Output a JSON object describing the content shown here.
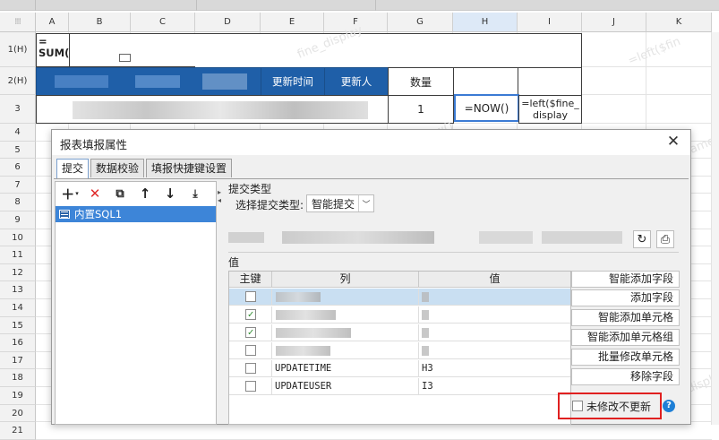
{
  "sheet": {
    "columns": [
      "A",
      "B",
      "C",
      "D",
      "E",
      "F",
      "G",
      "H",
      "I",
      "J",
      "K"
    ],
    "rows": [
      "1(H)",
      "2(H)",
      "3",
      "4",
      "5",
      "6",
      "7",
      "8",
      "9",
      "10",
      "11",
      "12",
      "13",
      "14",
      "15",
      "16",
      "17",
      "18",
      "19",
      "20",
      "21"
    ],
    "cells": {
      "a1": "= SUM(",
      "e2": "更新时间",
      "f2": "更新人",
      "g2": "数量",
      "g3": "1",
      "h3": "=NOW()",
      "i3": "=left($fine_display"
    },
    "watermarks": [
      "fine_display",
      "=left($fin",
      "now()",
      "ame",
      "_display"
    ]
  },
  "dialog": {
    "title": "报表填报属性",
    "close_icon": "close-icon",
    "tabs": [
      {
        "label": "提交",
        "active": true
      },
      {
        "label": "数据校验",
        "active": false
      },
      {
        "label": "填报快捷键设置",
        "active": false
      }
    ],
    "left": {
      "toolbar": [
        "add-icon",
        "delete-icon",
        "copy-icon",
        "move-up-icon",
        "move-down-icon",
        "move-bottom-icon"
      ],
      "items": [
        {
          "label": "内置SQL1",
          "selected": true
        }
      ]
    },
    "right": {
      "submit_type_heading": "提交类型",
      "submit_type_label": "选择提交类型:",
      "submit_type_value": "智能提交",
      "value_heading": "值",
      "grid": {
        "headers": [
          "主键",
          "列",
          "值"
        ],
        "rows": [
          {
            "key": false,
            "column": "",
            "value": "",
            "selected": true
          },
          {
            "key": true,
            "column": "",
            "value": "",
            "selected": false
          },
          {
            "key": true,
            "column": "",
            "value": "",
            "selected": false
          },
          {
            "key": false,
            "column": "",
            "value": "",
            "selected": false
          },
          {
            "key": false,
            "column": "UPDATETIME",
            "value": "H3",
            "selected": false
          },
          {
            "key": false,
            "column": "UPDATEUSER",
            "value": "I3",
            "selected": false
          }
        ]
      },
      "buttons": [
        "智能添加字段",
        "添加字段",
        "智能添加单元格",
        "智能添加单元格组",
        "批量修改单元格",
        "移除字段"
      ],
      "unmodified_label": "未修改不更新",
      "colors": {
        "accent": "#3d85d8",
        "header_blue": "#1f5fa8",
        "highlight": "#e02020"
      }
    }
  }
}
